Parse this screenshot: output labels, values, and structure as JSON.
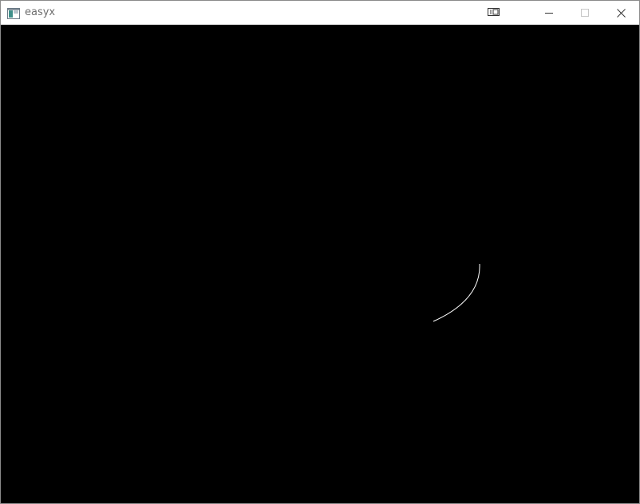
{
  "window": {
    "title": "easyx",
    "icon": "app-window-icon",
    "controls": [
      "minimize-icon",
      "maximize-icon",
      "close-icon"
    ],
    "extra_button_icon": "window-cast-icon"
  },
  "canvas": {
    "background": "#000000",
    "stroke_color": "#ffffff",
    "shape": "arc"
  }
}
